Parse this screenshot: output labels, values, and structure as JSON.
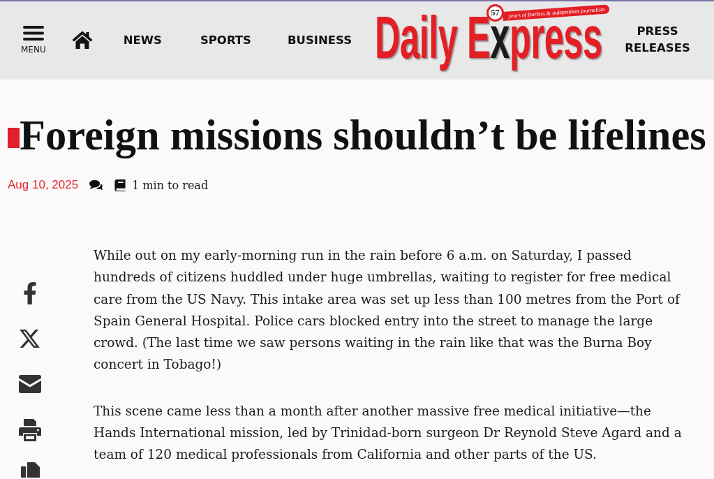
{
  "header": {
    "menu": {
      "label": "MENU"
    },
    "nav": [
      {
        "kind": "home"
      },
      {
        "kind": "text",
        "label": "NEWS"
      },
      {
        "kind": "text",
        "label": "SPORTS"
      },
      {
        "kind": "text",
        "label": "BUSINESS"
      }
    ],
    "logo": {
      "name_start": "Daily E",
      "name_accent": "x",
      "name_end": "press",
      "badge": "57",
      "tagline": "years of fearless & independent journalism"
    },
    "press_link": "PRESS RELEASES"
  },
  "article": {
    "title": "Foreign missions shouldn’t be lifelines",
    "date": "Aug 10, 2025",
    "read_time": "1 min to read",
    "share": [
      {
        "kind": "facebook"
      },
      {
        "kind": "x"
      },
      {
        "kind": "email"
      },
      {
        "kind": "print"
      },
      {
        "kind": "copy"
      }
    ],
    "paragraphs": [
      "While out on my early-morning run in the rain before 6 a.m. on Saturday, I passed hundreds of citizens huddled under huge umbrellas, waiting to register for free medical care from the US Navy. This intake area was set up less than 100 metres from the Port of Spain General Hospital. Police cars blocked entry into the street to manage the large crowd. (The last time we saw persons waiting in the rain like that was the Burna Boy concert in Tobago!)",
      "This scene came less than a month after another massive free medical initiative—the Hands International mission, led by Trinidad-born surgeon Dr Reynold Steve Agard and a team of 120 medical professionals from California and other parts of the US."
    ]
  }
}
